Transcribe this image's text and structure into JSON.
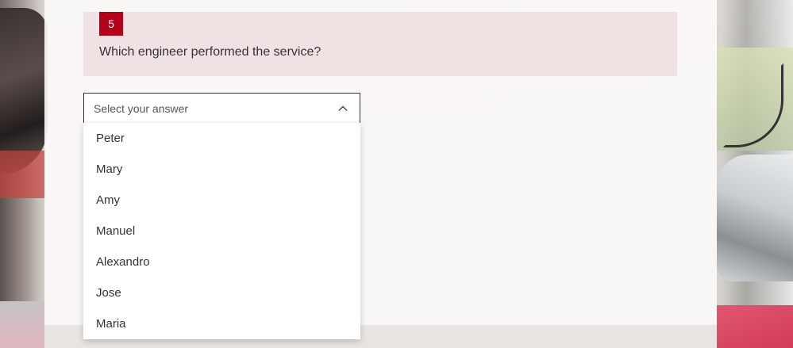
{
  "question": {
    "number": "5",
    "text": "Which engineer performed the service?"
  },
  "select": {
    "placeholder": "Select your answer",
    "options": [
      "Peter",
      "Mary",
      "Amy",
      "Manuel",
      "Alexandro",
      "Jose",
      "Maria"
    ]
  },
  "colors": {
    "accent": "#b3001b",
    "border_active": "#a80000"
  }
}
